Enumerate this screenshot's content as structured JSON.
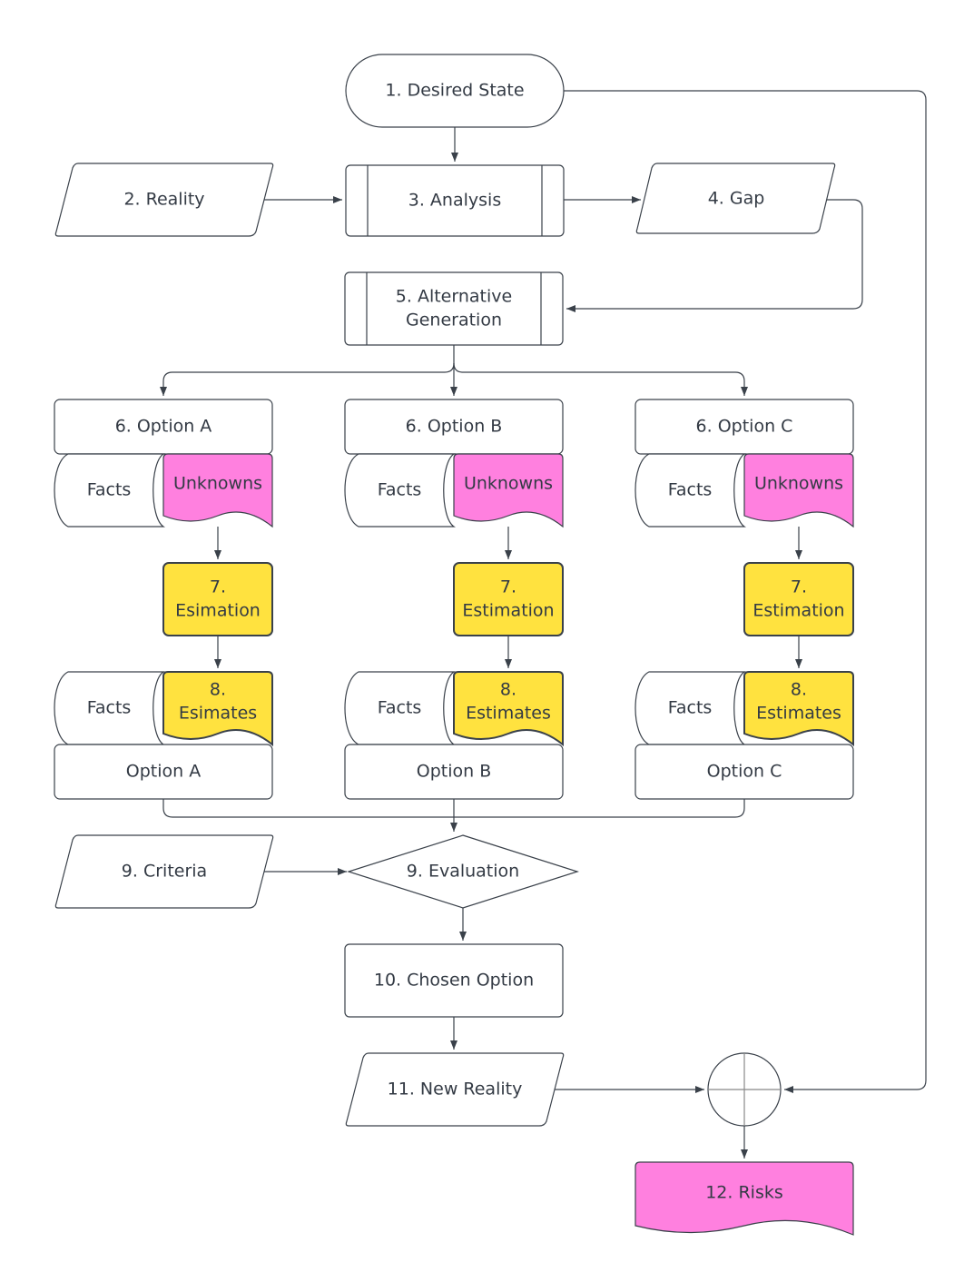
{
  "colors": {
    "stroke": "#3a414a",
    "pink": "#ff80df",
    "yellow": "#ffe23f",
    "text": "#333a44"
  },
  "nodes": {
    "desired_state": "1. Desired State",
    "reality": "2. Reality",
    "analysis": "3. Analysis",
    "gap": "4. Gap",
    "alt_gen_line1": "5. Alternative",
    "alt_gen_line2": "Generation",
    "criteria": "9. Criteria",
    "evaluation": "9. Evaluation",
    "chosen_option": "10. Chosen Option",
    "new_reality": "11. New Reality",
    "risks": "12. Risks"
  },
  "options": [
    {
      "header": "6. Option A",
      "facts": "Facts",
      "unknowns": "Unknowns",
      "estimation_num": "7.",
      "estimation": "Esimation",
      "facts2": "Facts",
      "estimates_num": "8.",
      "estimates": "Esimates",
      "footer": "Option A"
    },
    {
      "header": "6. Option B",
      "facts": "Facts",
      "unknowns": "Unknowns",
      "estimation_num": "7.",
      "estimation": "Estimation",
      "facts2": "Facts",
      "estimates_num": "8.",
      "estimates": "Estimates",
      "footer": "Option B"
    },
    {
      "header": "6. Option C",
      "facts": "Facts",
      "unknowns": "Unknowns",
      "estimation_num": "7.",
      "estimation": "Estimation",
      "facts2": "Facts",
      "estimates_num": "8.",
      "estimates": "Estimates",
      "footer": "Option C"
    }
  ]
}
